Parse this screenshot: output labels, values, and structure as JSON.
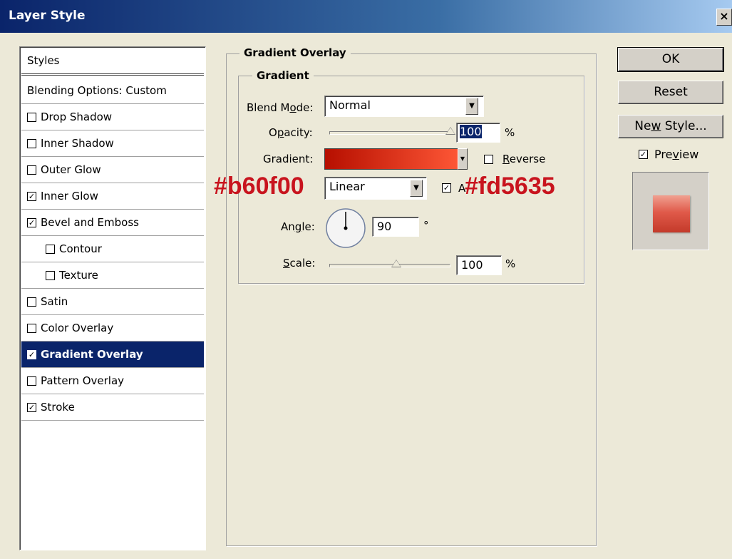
{
  "window": {
    "title": "Layer Style",
    "close_label": "×"
  },
  "styles": {
    "header": "Styles",
    "items": [
      {
        "label": "Blending Options: Custom",
        "has_checkbox": false,
        "checked": false,
        "indent": false,
        "selected": false
      },
      {
        "label": "Drop Shadow",
        "has_checkbox": true,
        "checked": false,
        "indent": false,
        "selected": false
      },
      {
        "label": "Inner Shadow",
        "has_checkbox": true,
        "checked": false,
        "indent": false,
        "selected": false
      },
      {
        "label": "Outer Glow",
        "has_checkbox": true,
        "checked": false,
        "indent": false,
        "selected": false
      },
      {
        "label": "Inner Glow",
        "has_checkbox": true,
        "checked": true,
        "indent": false,
        "selected": false
      },
      {
        "label": "Bevel and Emboss",
        "has_checkbox": true,
        "checked": true,
        "indent": false,
        "selected": false
      },
      {
        "label": "Contour",
        "has_checkbox": true,
        "checked": false,
        "indent": true,
        "selected": false
      },
      {
        "label": "Texture",
        "has_checkbox": true,
        "checked": false,
        "indent": true,
        "selected": false
      },
      {
        "label": "Satin",
        "has_checkbox": true,
        "checked": false,
        "indent": false,
        "selected": false
      },
      {
        "label": "Color Overlay",
        "has_checkbox": true,
        "checked": false,
        "indent": false,
        "selected": false
      },
      {
        "label": "Gradient Overlay",
        "has_checkbox": true,
        "checked": true,
        "indent": false,
        "selected": true
      },
      {
        "label": "Pattern Overlay",
        "has_checkbox": true,
        "checked": false,
        "indent": false,
        "selected": false
      },
      {
        "label": "Stroke",
        "has_checkbox": true,
        "checked": true,
        "indent": false,
        "selected": false
      }
    ]
  },
  "gradient_overlay": {
    "section_title": "Gradient Overlay",
    "group_title": "Gradient",
    "blend_mode": {
      "label": "Blend Mode:",
      "value": "Normal"
    },
    "opacity": {
      "label": "Opacity:",
      "value": "100",
      "unit": "%",
      "level": 1.0
    },
    "gradient": {
      "label": "Gradient:",
      "start_color": "#b60f00",
      "end_color": "#fd5635",
      "reverse_label": "Reverse",
      "reverse_checked": false
    },
    "style": {
      "value": "Linear",
      "align_checked": true,
      "align_label": "A"
    },
    "angle": {
      "label": "Angle:",
      "value": "90",
      "unit": "°",
      "degrees": 90
    },
    "scale": {
      "label": "Scale:",
      "value": "100",
      "unit": "%",
      "level": 0.55
    }
  },
  "buttons": {
    "ok": "OK",
    "reset": "Reset",
    "new_style": "New Style...",
    "preview_label": "Preview",
    "preview_checked": true
  },
  "annotations": {
    "start_color": "#b60f00",
    "end_color": "#fd5635"
  },
  "colors": {
    "selection": "#0a246a",
    "preview_swatch": "#e05a4a"
  }
}
